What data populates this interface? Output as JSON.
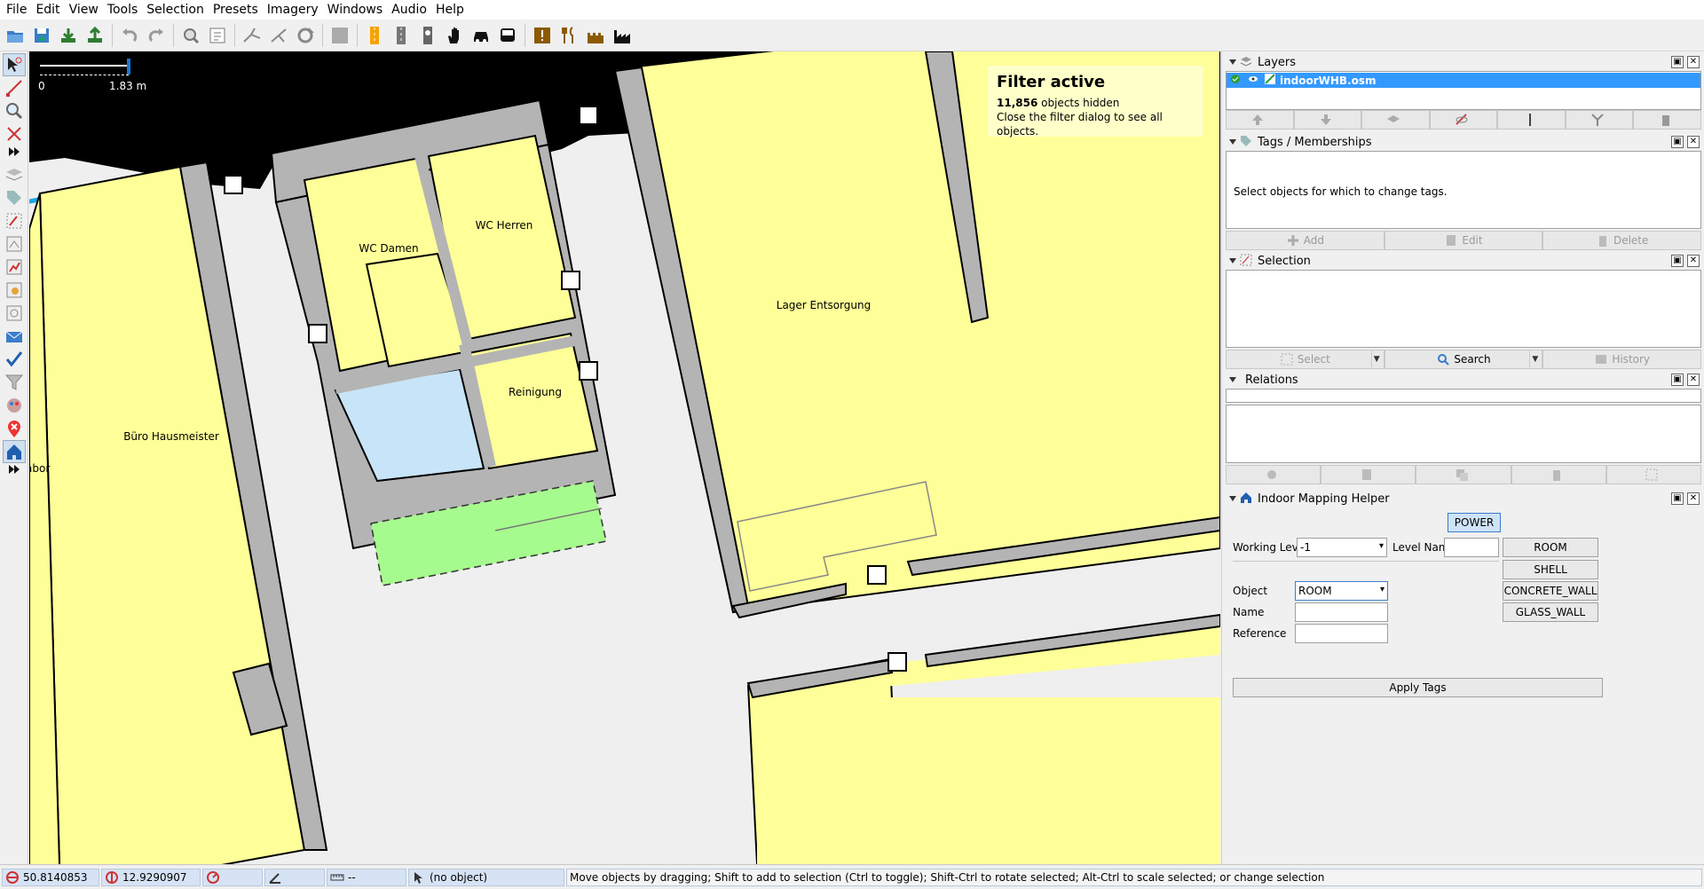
{
  "menu": [
    "File",
    "Edit",
    "View",
    "Tools",
    "Selection",
    "Presets",
    "Imagery",
    "Windows",
    "Audio",
    "Help"
  ],
  "toolbar_icons": [
    "open-icon",
    "save-icon",
    "download-icon",
    "upload-icon",
    "undo-icon",
    "redo-icon",
    "preferences-icon",
    "info-icon",
    "split-icon",
    "combine-icon",
    "refresh-icon",
    "background-icon",
    "road-icon",
    "track-icon",
    "pedestrian-icon",
    "hand-icon",
    "car-icon",
    "bus-icon",
    "warning-icon",
    "restaurant-icon",
    "castle-icon",
    "industry-icon"
  ],
  "left_tools": [
    "select-tool-icon",
    "draw-tool-icon",
    "zoom-tool-icon",
    "improve-way-tool-icon",
    "more-tools-icon",
    "layers-toggle-icon",
    "tags-toggle-icon",
    "selection-toggle-icon",
    "relations-toggle-icon",
    "validator-icon",
    "history-icon",
    "commands-icon",
    "conflict-icon",
    "filter-icon",
    "author-icon",
    "notes-icon",
    "indoor-helper-icon",
    "more-icon"
  ],
  "map": {
    "scale": {
      "zero": "0",
      "length": "1.83 m"
    },
    "filter": {
      "title": "Filter active",
      "count": "11,856",
      "hidden_text": "objects hidden",
      "hint": "Close the filter dialog to see all objects."
    },
    "rooms": {
      "wc_damen": "WC Damen",
      "wc_herren": "WC Herren",
      "reinigung": "Reinigung",
      "lager": "Lager Entsorgung",
      "buero": "Büro Hausmeister",
      "labor": "abor"
    }
  },
  "panels": {
    "layers": {
      "title": "Layers",
      "layer_name": "indoorWHB.osm"
    },
    "tags": {
      "title": "Tags / Memberships",
      "empty": "Select objects for which to change tags.",
      "add": "Add",
      "edit": "Edit",
      "delete": "Delete"
    },
    "selection": {
      "title": "Selection",
      "select": "Select",
      "search": "Search",
      "history": "History"
    },
    "relations": {
      "title": "Relations"
    },
    "indoor": {
      "title": "Indoor Mapping Helper",
      "power": "POWER",
      "working_level_label": "Working Level",
      "working_level": "-1",
      "level_name_label": "Level Name",
      "level_name": "",
      "room_btn": "ROOM",
      "shell_btn": "SHELL",
      "concrete_btn": "CONCRETE_WALL",
      "glass_btn": "GLASS_WALL",
      "object_label": "Object",
      "object": "ROOM",
      "name_label": "Name",
      "name": "",
      "reference_label": "Reference",
      "reference": "",
      "apply": "Apply Tags"
    }
  },
  "status": {
    "lat": "50.8140853",
    "lon": "12.9290907",
    "heading": "",
    "angle": "",
    "length": "--",
    "object": "(no object)",
    "message": "Move objects by dragging; Shift to add to selection (Ctrl to toggle); Shift-Ctrl to rotate selected; Alt-Ctrl to scale selected; or change selection"
  },
  "colors": {
    "room": "#ffff99",
    "wall": "#b4b4b4",
    "corridor": "#efefef",
    "selected_area": "#c8e4f8",
    "green_area": "#a6fb8e",
    "layer_highlight": "#3399ff"
  }
}
